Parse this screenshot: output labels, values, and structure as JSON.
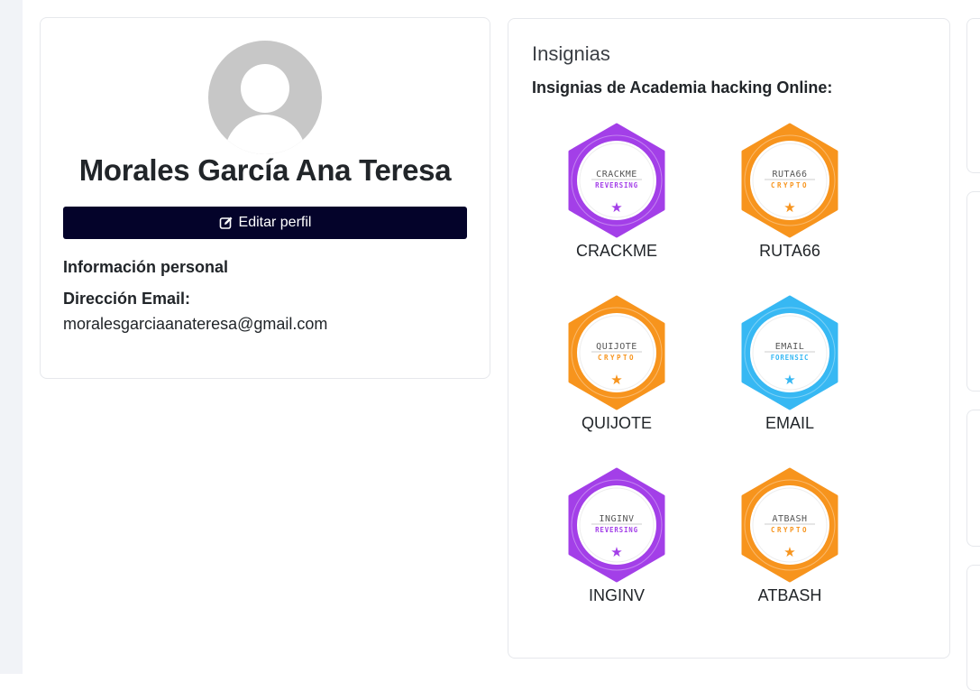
{
  "profile": {
    "name": "Morales García Ana Teresa",
    "edit_button_label": "Editar perfil",
    "personal_info_title": "Información personal",
    "email_label": "Dirección Email:",
    "email_value": "moralesgarciaanateresa@gmail.com"
  },
  "badges_section": {
    "title": "Insignias",
    "subtitle": "Insignias de Academia hacking Online:",
    "badges": [
      {
        "name": "CRACKME",
        "logo_text": "CRACKME",
        "category": "REVERSING",
        "color": "#a33fe8",
        "category_color": "#a33fe8"
      },
      {
        "name": "RUTA66",
        "logo_text": "RUTA66",
        "category": "CRYPTO",
        "color": "#f7941d",
        "category_color": "#f7941d"
      },
      {
        "name": "QUIJOTE",
        "logo_text": "QUIJOTE",
        "category": "CRYPTO",
        "color": "#f7941d",
        "category_color": "#f7941d"
      },
      {
        "name": "EMAIL",
        "logo_text": "EMAIL",
        "category": "FORENSIC",
        "color": "#37b8f3",
        "category_color": "#37b8f3"
      },
      {
        "name": "INGINV",
        "logo_text": "INGINV",
        "category": "REVERSING",
        "color": "#a33fe8",
        "category_color": "#a33fe8"
      },
      {
        "name": "ATBASH",
        "logo_text": "ATBASH",
        "category": "CRYPTO",
        "color": "#f7941d",
        "category_color": "#f7941d"
      }
    ]
  }
}
